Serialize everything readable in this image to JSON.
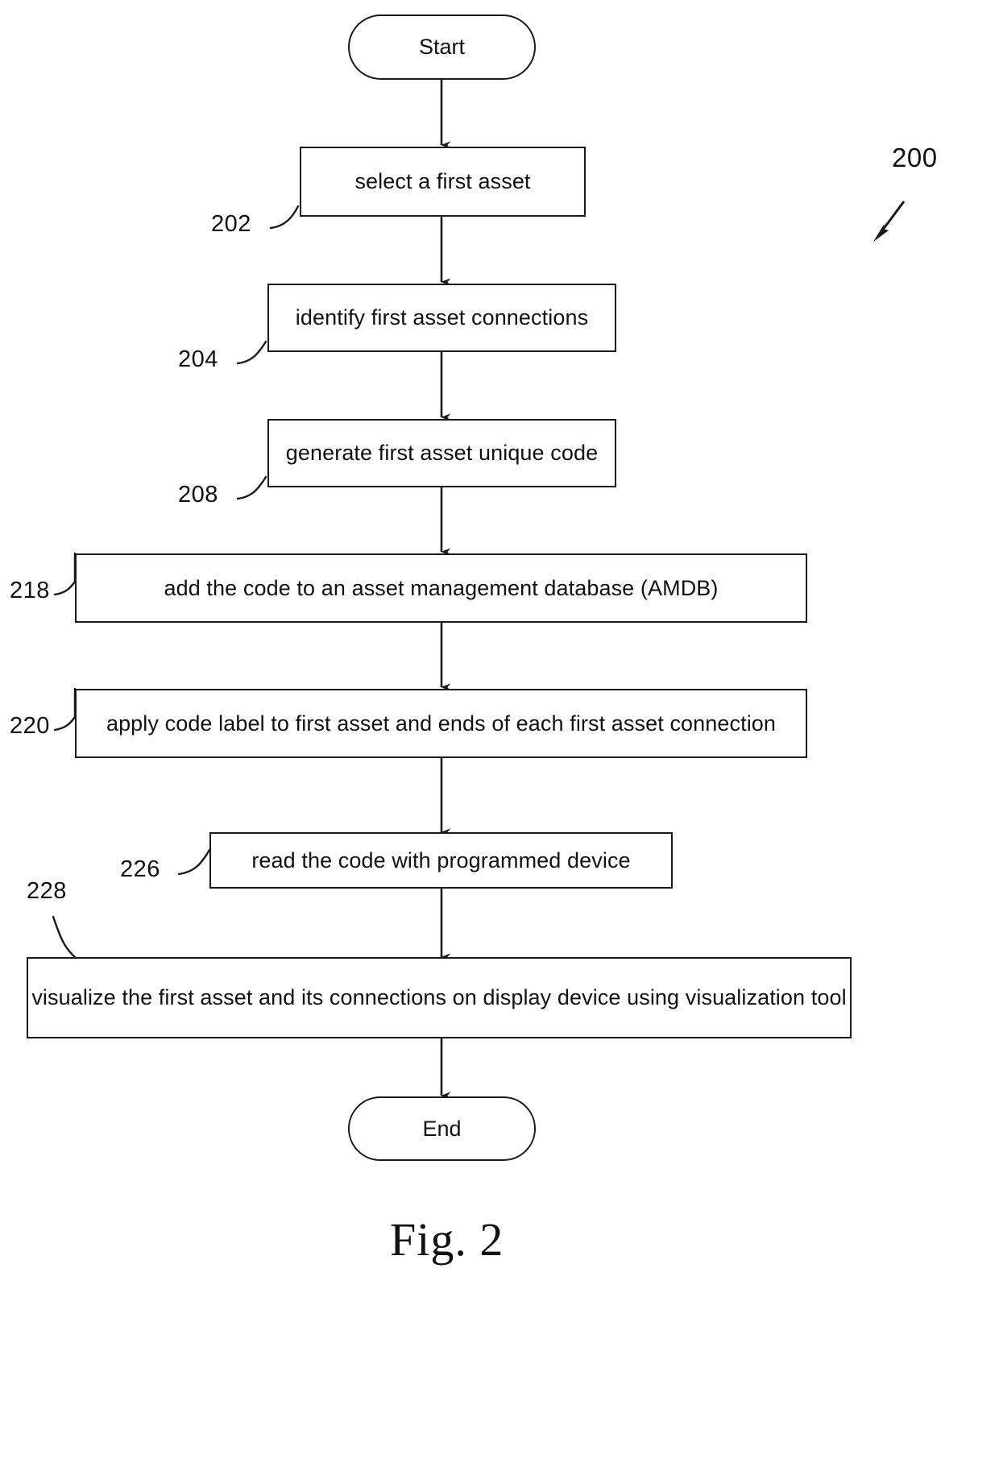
{
  "figure": {
    "caption": "Fig. 2",
    "diagram_ref": "200"
  },
  "nodes": [
    {
      "id": "start",
      "shape": "terminal",
      "label": "Start",
      "ref": null
    },
    {
      "id": "select-first-asset",
      "shape": "process",
      "label": "select a first asset",
      "ref": "202"
    },
    {
      "id": "identify-connections",
      "shape": "process",
      "label": "identify first asset connections",
      "ref": "204"
    },
    {
      "id": "generate-unique-code",
      "shape": "process",
      "label": "generate first asset unique code",
      "ref": "208"
    },
    {
      "id": "add-code-to-amdb",
      "shape": "process",
      "label": "add the code to an asset management database (AMDB)",
      "ref": "218"
    },
    {
      "id": "apply-code-label",
      "shape": "process",
      "label": "apply code label to first asset and ends of each first asset connection",
      "ref": "220"
    },
    {
      "id": "read-code",
      "shape": "process",
      "label": "read the code with programmed device",
      "ref": "226"
    },
    {
      "id": "visualize-asset",
      "shape": "process",
      "label": "visualize the first asset and its connections on display device using visualization tool",
      "ref": "228"
    },
    {
      "id": "end",
      "shape": "terminal",
      "label": "End",
      "ref": null
    }
  ],
  "colors": {
    "stroke": "#1a1a1a",
    "text": "#111111",
    "background": "#ffffff"
  }
}
